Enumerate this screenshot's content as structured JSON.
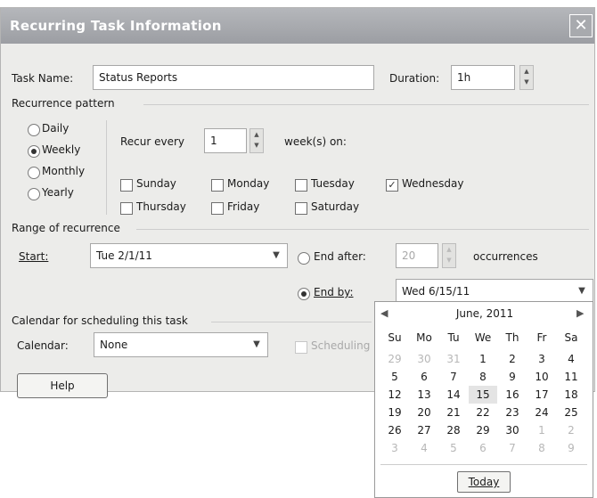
{
  "dialog": {
    "title": "Recurring Task Information",
    "close_glyph": "✕"
  },
  "task": {
    "name_label": "Task Name:",
    "name_value": "Status Reports",
    "duration_label": "Duration:",
    "duration_value": "1h"
  },
  "pattern": {
    "section_label": "Recurrence pattern",
    "options": [
      {
        "label": "Daily",
        "selected": false
      },
      {
        "label": "Weekly",
        "selected": true
      },
      {
        "label": "Monthly",
        "selected": false
      },
      {
        "label": "Yearly",
        "selected": false
      }
    ],
    "recur_every_label": "Recur every",
    "recur_every_value": "1",
    "weeks_on_label": "week(s) on:",
    "days": [
      {
        "label": "Sunday",
        "checked": false
      },
      {
        "label": "Monday",
        "checked": false
      },
      {
        "label": "Tuesday",
        "checked": false
      },
      {
        "label": "Wednesday",
        "checked": true
      },
      {
        "label": "Thursday",
        "checked": false
      },
      {
        "label": "Friday",
        "checked": false
      },
      {
        "label": "Saturday",
        "checked": false
      }
    ]
  },
  "range": {
    "section_label": "Range of recurrence",
    "start_label": "Start:",
    "start_value": "Tue 2/1/11",
    "end_after_label": "End after:",
    "end_after_value": "20",
    "occurrences_label": "occurrences",
    "end_by_label": "End by:",
    "end_by_value": "Wed 6/15/11",
    "end_by_selected": true
  },
  "calendar_section": {
    "section_label": "Calendar for scheduling this task",
    "calendar_label": "Calendar:",
    "calendar_value": "None",
    "scheduling_label": "Scheduling"
  },
  "help_button": "Help",
  "datepicker": {
    "prev_glyph": "◀",
    "next_glyph": "▶",
    "month_label": "June, 2011",
    "weekdays": [
      "Su",
      "Mo",
      "Tu",
      "We",
      "Th",
      "Fr",
      "Sa"
    ],
    "weeks": [
      [
        {
          "d": "29",
          "o": true
        },
        {
          "d": "30",
          "o": true
        },
        {
          "d": "31",
          "o": true
        },
        {
          "d": "1"
        },
        {
          "d": "2"
        },
        {
          "d": "3"
        },
        {
          "d": "4"
        }
      ],
      [
        {
          "d": "5"
        },
        {
          "d": "6"
        },
        {
          "d": "7"
        },
        {
          "d": "8"
        },
        {
          "d": "9"
        },
        {
          "d": "10"
        },
        {
          "d": "11"
        }
      ],
      [
        {
          "d": "12"
        },
        {
          "d": "13"
        },
        {
          "d": "14"
        },
        {
          "d": "15",
          "sel": true
        },
        {
          "d": "16"
        },
        {
          "d": "17"
        },
        {
          "d": "18"
        }
      ],
      [
        {
          "d": "19"
        },
        {
          "d": "20"
        },
        {
          "d": "21"
        },
        {
          "d": "22"
        },
        {
          "d": "23"
        },
        {
          "d": "24"
        },
        {
          "d": "25"
        }
      ],
      [
        {
          "d": "26"
        },
        {
          "d": "27"
        },
        {
          "d": "28"
        },
        {
          "d": "29"
        },
        {
          "d": "30"
        },
        {
          "d": "1",
          "o": true
        },
        {
          "d": "2",
          "o": true
        }
      ],
      [
        {
          "d": "3",
          "o": true
        },
        {
          "d": "4",
          "o": true
        },
        {
          "d": "5",
          "o": true
        },
        {
          "d": "6",
          "o": true
        },
        {
          "d": "7",
          "o": true
        },
        {
          "d": "8",
          "o": true
        },
        {
          "d": "9",
          "o": true
        }
      ]
    ],
    "today_button": "Today"
  }
}
